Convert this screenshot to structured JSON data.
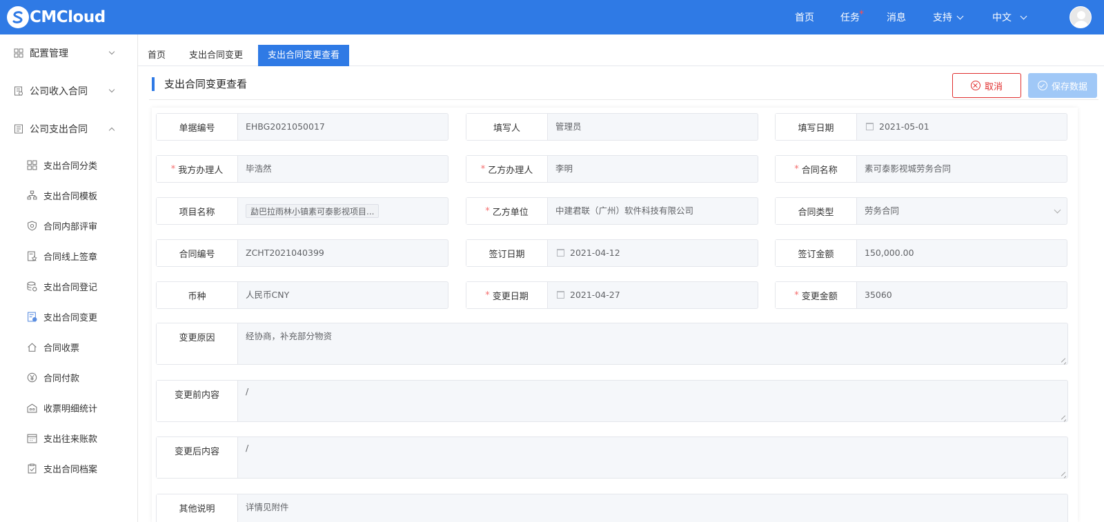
{
  "app": {
    "logo_text": "CMCloud",
    "accent_color": "#2f7ae5"
  },
  "topnav": {
    "home": "首页",
    "tasks": "任务",
    "task_marker": "*",
    "messages": "消息",
    "support": "支持",
    "language": "中文"
  },
  "sidebar": {
    "groups": [
      {
        "label": "配置管理",
        "expanded": false
      },
      {
        "label": "公司收入合同",
        "expanded": false
      },
      {
        "label": "公司支出合同",
        "expanded": true
      }
    ],
    "items": [
      {
        "label": "支出合同分类",
        "icon": "grid-icon"
      },
      {
        "label": "支出合同模板",
        "icon": "sitemap-icon"
      },
      {
        "label": "合同内部评审",
        "icon": "shield-icon"
      },
      {
        "label": "合同线上签章",
        "icon": "document-star-icon"
      },
      {
        "label": "支出合同登记",
        "icon": "database-icon"
      },
      {
        "label": "支出合同变更",
        "icon": "document-edit-icon"
      },
      {
        "label": "合同收票",
        "icon": "home-icon"
      },
      {
        "label": "合同付款",
        "icon": "yen-icon"
      },
      {
        "label": "收票明细统计",
        "icon": "building-icon"
      },
      {
        "label": "支出往来账款",
        "icon": "calendar-icon"
      },
      {
        "label": "支出合同档案",
        "icon": "clipboard-icon"
      }
    ]
  },
  "tabs": [
    {
      "label": "首页",
      "active": false
    },
    {
      "label": "支出合同变更",
      "active": false
    },
    {
      "label": "支出合同变更查看",
      "active": true
    }
  ],
  "page": {
    "title": "支出合同变更查看",
    "cancel_label": "取消",
    "save_label": "保存数据"
  },
  "form": {
    "doc_no": {
      "label": "单据编号",
      "value": "EHBG2021050017"
    },
    "filler": {
      "label": "填写人",
      "value": "管理员"
    },
    "fill_date": {
      "label": "填写日期",
      "value": "2021-05-01"
    },
    "our_handler": {
      "label": "我方办理人",
      "value": "毕浩然",
      "required": "*"
    },
    "party_b_handler": {
      "label": "乙方办理人",
      "value": "李明",
      "required": "*"
    },
    "contract_name": {
      "label": "合同名称",
      "value": "素可泰影视城劳务合同",
      "required": "*"
    },
    "project_name": {
      "label": "项目名称",
      "value": "勐巴拉雨林小镇素可泰影视项目..."
    },
    "party_b_unit": {
      "label": "乙方单位",
      "value": "中建君联（广州）软件科技有限公司",
      "required": "*"
    },
    "contract_type": {
      "label": "合同类型",
      "value": "劳务合同"
    },
    "contract_no": {
      "label": "合同编号",
      "value": "ZCHT2021040399"
    },
    "sign_date": {
      "label": "签订日期",
      "value": "2021-04-12"
    },
    "sign_amount": {
      "label": "签订金额",
      "value": "150,000.00"
    },
    "currency": {
      "label": "币种",
      "value": "人民币CNY"
    },
    "change_date": {
      "label": "变更日期",
      "value": "2021-04-27",
      "required": "*"
    },
    "change_amount": {
      "label": "变更金额",
      "value": "35060",
      "required": "*"
    },
    "change_reason": {
      "label": "变更原因",
      "value": "经协商，补充部分物资"
    },
    "before_content": {
      "label": "变更前内容",
      "value": "/"
    },
    "after_content": {
      "label": "变更后内容",
      "value": "/"
    },
    "other_notes": {
      "label": "其他说明",
      "value": "详情见附件"
    }
  }
}
